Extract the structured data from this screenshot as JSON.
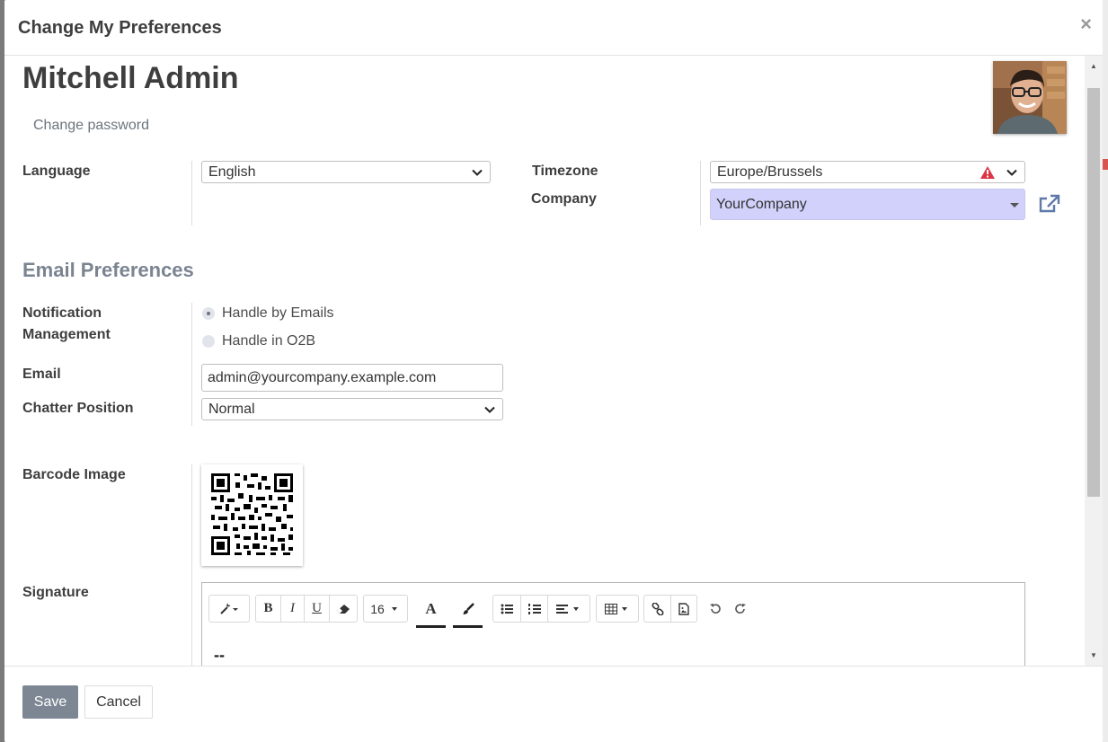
{
  "dialog": {
    "title": "Change My Preferences",
    "close_symbol": "×"
  },
  "user": {
    "name": "Mitchell Admin",
    "change_password": "Change password"
  },
  "fields": {
    "language_label": "Language",
    "language_value": "English",
    "timezone_label": "Timezone",
    "timezone_value": "Europe/Brussels",
    "company_label": "Company",
    "company_value": "YourCompany"
  },
  "email_section": {
    "title": "Email Preferences",
    "notification_label_line1": "Notification",
    "notification_label_line2": "Management",
    "options": [
      {
        "label": "Handle by Emails",
        "selected": true
      },
      {
        "label": "Handle in O2B",
        "selected": false
      }
    ],
    "email_label": "Email",
    "email_value": "admin@yourcompany.example.com",
    "chatter_label": "Chatter Position",
    "chatter_value": "Normal"
  },
  "barcode_label": "Barcode Image",
  "signature": {
    "label": "Signature",
    "font_size": "16",
    "font_color_glyph": "A",
    "content": "--"
  },
  "footer": {
    "save": "Save",
    "cancel": "Cancel"
  },
  "colors": {
    "accent": "#7d8794",
    "company_highlight": "#d1d1fb",
    "warning": "#dc3545",
    "link": "#5f79a8"
  }
}
